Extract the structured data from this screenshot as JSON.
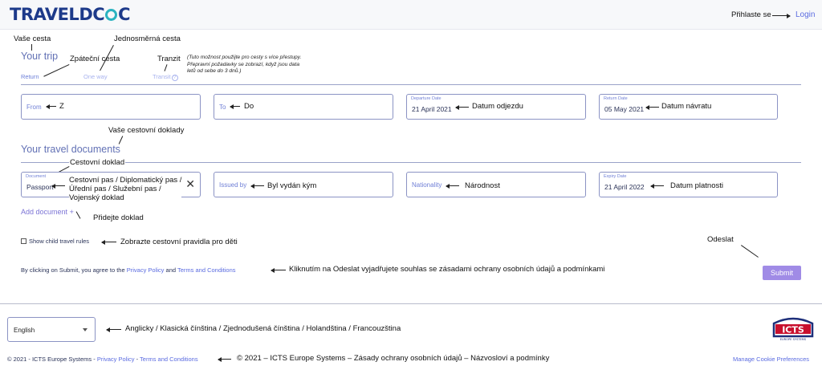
{
  "header": {
    "logo_text_a": "TRAVEL",
    "logo_text_b": "DC",
    "logo_text_c": "C",
    "login_note": "Přihlaste se",
    "login_label": "Login"
  },
  "annotations": {
    "your_trip": "Vaše cesta",
    "one_way": "Jednosměrná cesta",
    "return": "Zpáteční cesta",
    "transit": "Tranzit",
    "transit_info": [
      "(Tuto možnost použijte pro cesty s více přestupy.",
      "Přepravní požadavky se zobrazí, když jsou data",
      "letů od sebe do 3 dnů.)"
    ],
    "from": "Z",
    "to": "Do",
    "departure": "Datum odjezdu",
    "return_date": "Datum návratu",
    "travel_docs": "Vaše cestovní doklady",
    "document": "Cestovní doklad",
    "passport_types": [
      "Cestovní pas / Diplomatický pas /",
      "Úřední pas / Služební pas /",
      "Vojenský doklad"
    ],
    "issued_by": "Byl vydán kým",
    "nationality": "Národnost",
    "expiry": "Datum platnosti",
    "add_document": "Přidejte doklad",
    "child_rules": "Zobrazte cestovní pravidla pro děti",
    "submit": "Odeslat",
    "consent": "Kliknutím na Odeslat vyjadřujete souhlas se zásadami ochrany osobních údajů a podmínkami",
    "languages": "Anglicky / Klasická čínština / Zjednodušená čínština / Holandština / Francouzština",
    "footer": "© 2021 – ICTS Europe Systems – Zásady ochrany osobních údajů – Názvosloví a podmínky"
  },
  "trip": {
    "title": "Your trip",
    "options": [
      "Return",
      "One way",
      "Transit"
    ]
  },
  "fields": {
    "from_placeholder": "From",
    "to_placeholder": "To",
    "departure_label": "Departure Date",
    "departure_value": "21 April 2021",
    "return_label": "Return Date",
    "return_value": "05 May 2021"
  },
  "documents": {
    "title": "Your travel documents",
    "document_label": "Document",
    "document_value": "Passport",
    "issued_by_placeholder": "Issued by",
    "nationality_placeholder": "Nationality",
    "expiry_label": "Expiry Date",
    "expiry_value": "21 April 2022",
    "add_document": "Add document",
    "add_icon": "+"
  },
  "options": {
    "child_rules": "Show child travel rules"
  },
  "consent": {
    "prefix": "By clicking on Submit, you agree to the ",
    "privacy": "Privacy Policy",
    "and": " and ",
    "terms": "Terms and Conditions"
  },
  "submit_label": "Submit",
  "footer": {
    "language": "English",
    "copyright": "© 2021 - ICTS Europe Systems - ",
    "privacy": "Privacy Policy",
    "sep": " - ",
    "terms": "Terms and Conditions",
    "cookies": "Manage Cookie Preferences",
    "icts_logo": "ICTS",
    "icts_sub": "EUROPE SYSTEMS"
  },
  "colors": {
    "brand": "#1d3a8a",
    "accent": "#5a6be0",
    "submit": "#a08be6"
  }
}
